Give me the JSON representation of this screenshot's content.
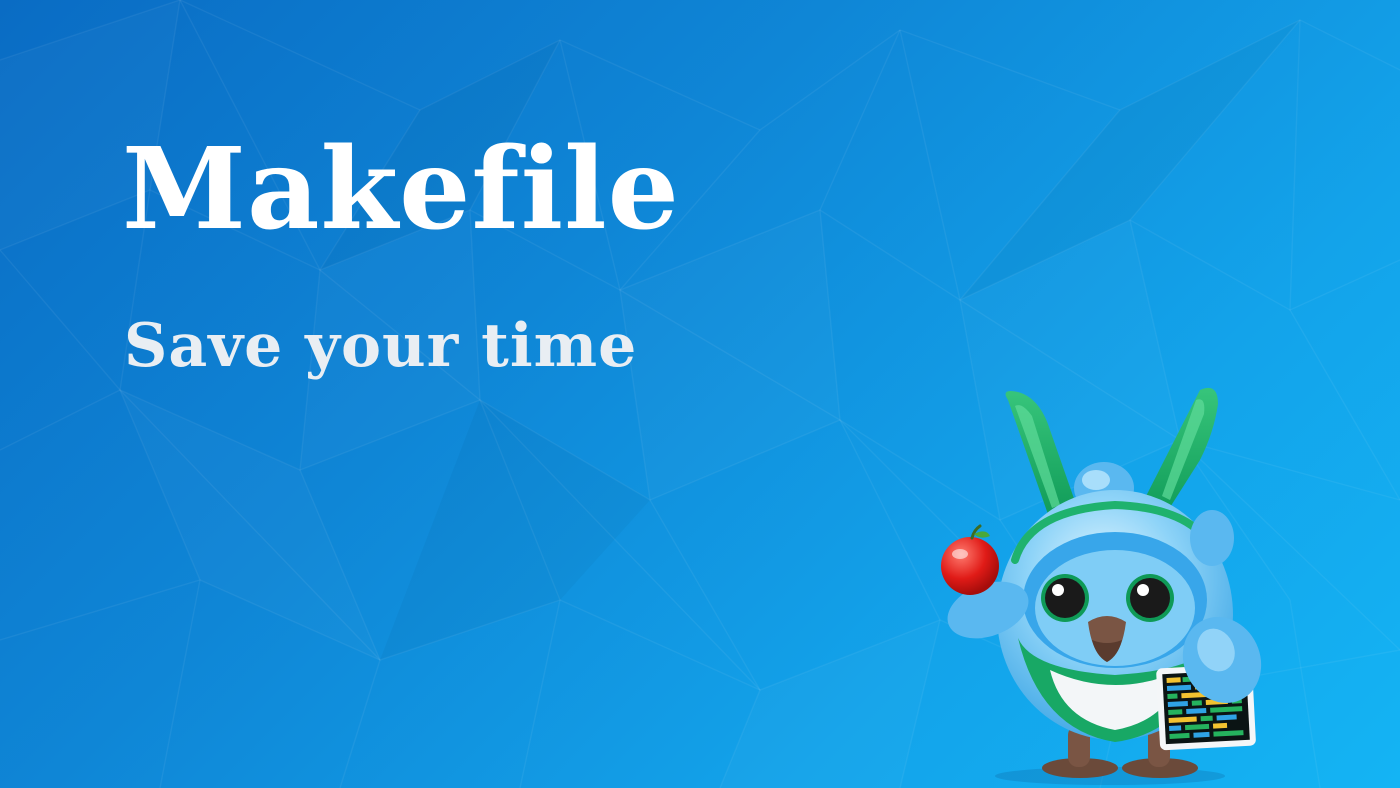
{
  "banner": {
    "title": "Makefile",
    "subtitle": "Save your time",
    "colors": {
      "background_dark": "#0a6cc4",
      "background_light": "#14b4f4",
      "title": "#ffffff",
      "subtitle": "#e9eef3"
    }
  },
  "mascot": {
    "icon": "bird-mascot-icon",
    "accessories": [
      "apple-icon",
      "terminal-tablet-icon"
    ]
  }
}
